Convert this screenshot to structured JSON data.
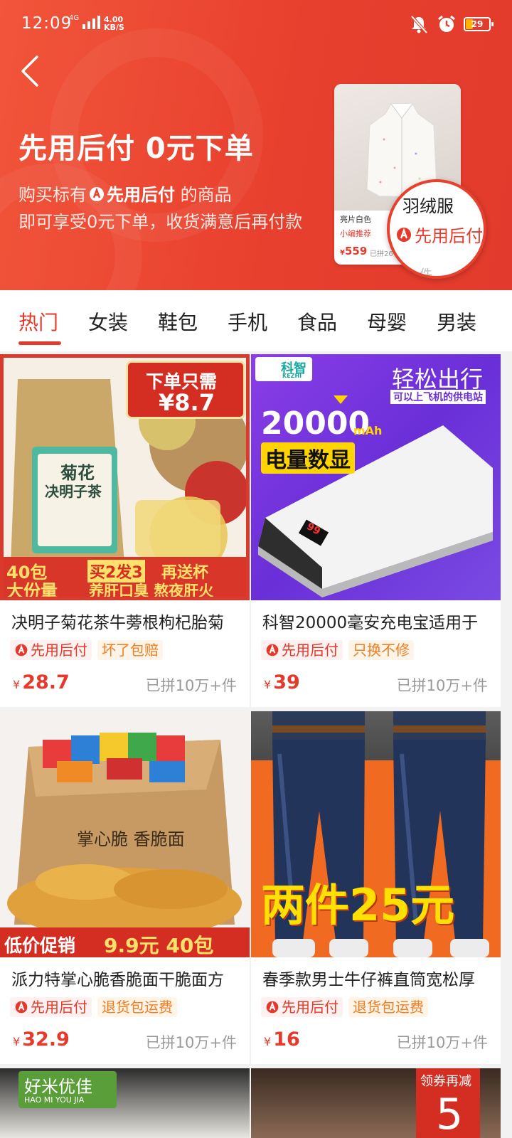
{
  "status_bar": {
    "time": "12:09",
    "network": "4G",
    "speed_value": "4.00",
    "speed_unit": "KB/S",
    "battery": "29"
  },
  "header": {
    "title": "先用后付 0元下单",
    "desc_prefix": "购买标有",
    "desc_badge": "先用后付",
    "desc_suffix": "的商品",
    "desc_line2": "即可享受0元下单，收货满意后再付款",
    "promo": {
      "line1": "亮片白色",
      "line2": "小编推荐",
      "price": "559",
      "sold": "已拼26",
      "magnifier_name": "羽绒服",
      "magnifier_badge": "先用后付",
      "magnifier_sub": "件"
    }
  },
  "tabs": [
    "热门",
    "女装",
    "鞋包",
    "手机",
    "食品",
    "母婴",
    "男装"
  ],
  "products": [
    {
      "name": "决明子菊花茶牛蒡根枸杞胎菊",
      "pay_tag": "先用后付",
      "service_tag": "坏了包赔",
      "currency": "¥",
      "price": "28.7",
      "sold": "已拼10万+件",
      "img": {
        "banner_top": "下单只需",
        "banner_price": "¥8.7",
        "pack_title1": "菊花",
        "pack_title2": "决明子茶",
        "bottom_left1": "40包",
        "bottom_left2": "大份量",
        "bottom_mid": "买2发3",
        "bottom_mid2": "再送杯",
        "bottom_slogan": "养肝口臭 熬夜肝火"
      }
    },
    {
      "name": "科智20000毫安充电宝适用于",
      "pay_tag": "先用后付",
      "service_tag": "只换不修",
      "currency": "¥",
      "price": "39",
      "sold": "已拼10万+件",
      "img": {
        "brand": "科智",
        "brand_en": "KEZHI",
        "headline": "轻松出行",
        "subline": "可以上飞机的供电站",
        "capacity": "20000",
        "unit": "mAh",
        "feature": "电量数显",
        "screen": "99"
      }
    },
    {
      "name": "派力特掌心脆香脆面干脆面方",
      "pay_tag": "先用后付",
      "service_tag": "退货包运费",
      "currency": "¥",
      "price": "32.9",
      "sold": "已拼10万+件",
      "img": {
        "box_text": "掌心脆 香脆面",
        "banner_left": "低价促销",
        "banner_right": "9.9元 40包"
      }
    },
    {
      "name": "春季款男士牛仔裤直筒宽松厚",
      "pay_tag": "先用后付",
      "service_tag": "退货包运费",
      "currency": "¥",
      "price": "16",
      "sold": "已拼10万+件",
      "img": {
        "headline": "两件25元"
      }
    }
  ],
  "next_row": {
    "left_brand": "好米优佳",
    "left_brand_en": "HAO MI YOU JIA",
    "right_badge": "领券再减",
    "right_number": "5"
  },
  "colors": {
    "accent": "#e53a2b",
    "service": "#f07d22"
  }
}
